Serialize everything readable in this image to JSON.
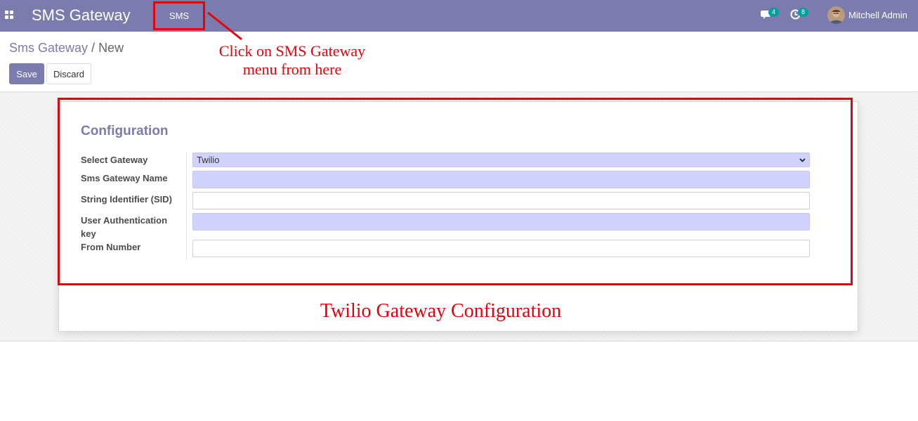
{
  "navbar": {
    "brand": "SMS Gateway",
    "menu_sms": "SMS",
    "messages_count": "4",
    "activities_count": "8",
    "user_name": "Mitchell Admin"
  },
  "breadcrumb": {
    "parent": "Sms Gateway",
    "separator": "/",
    "current": "New"
  },
  "buttons": {
    "save": "Save",
    "discard": "Discard"
  },
  "form": {
    "section_title": "Configuration",
    "fields": {
      "select_gateway": {
        "label": "Select Gateway",
        "value": "Twilio"
      },
      "gateway_name": {
        "label": "Sms Gateway Name",
        "value": ""
      },
      "sid": {
        "label": "String Identifier (SID)",
        "value": ""
      },
      "auth_key": {
        "label": "User Authentication key",
        "value": ""
      },
      "from_number": {
        "label": "From Number",
        "value": ""
      }
    }
  },
  "annotations": {
    "click_note": "Click on SMS Gateway menu from here",
    "twilio_note": "Twilio Gateway Configuration"
  },
  "colors": {
    "navbar": "#7c7bad",
    "badge": "#00a09d",
    "required_field": "#d2d2ff",
    "annotation": "#e8000b"
  },
  "icons": {
    "apps": "apps-grid-icon",
    "messages": "chat-bubble-icon",
    "activities": "clock-icon",
    "select": "chevron-down-icon"
  }
}
